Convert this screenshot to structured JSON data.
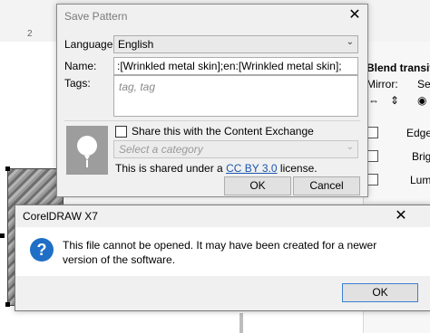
{
  "background": {
    "ruler_number": "2",
    "panel": {
      "title": "Blend transitio",
      "mirror_label": "Mirror:",
      "seamless_label": "Sea",
      "edge_label": "Edge",
      "brightness_label": "Brig",
      "luminance_label": "Lum"
    }
  },
  "save_dialog": {
    "title": "Save Pattern",
    "language_label": "Language:",
    "language_value": "English",
    "name_label": "Name:",
    "name_value": ":[Wrinkled metal skin];en:[Wrinkled metal skin];",
    "tags_label": "Tags:",
    "tags_placeholder": "tag, tag",
    "share_label": "Share this with the Content Exchange",
    "share_checked": false,
    "category_placeholder": "Select a category",
    "license_prefix": "This is shared under a",
    "license_link": "CC BY 3.0",
    "license_suffix": "license.",
    "ok_label": "OK",
    "cancel_label": "Cancel"
  },
  "alert_dialog": {
    "title": "CorelDRAW X7",
    "icon": "question-icon",
    "icon_color": "#1f6fc6",
    "message": "This file cannot be opened.  It may have been created for a newer version of the software.",
    "ok_label": "OK"
  }
}
